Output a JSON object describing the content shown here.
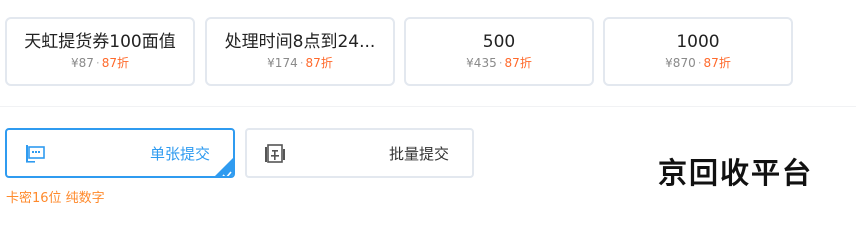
{
  "denominations": [
    {
      "title": "天虹提货券100面值",
      "price": "¥87",
      "separator": "·",
      "discount": "87折"
    },
    {
      "title": "处理时间8点到24...",
      "price": "¥174",
      "separator": "·",
      "discount": "87折"
    },
    {
      "title": "500",
      "price": "¥435",
      "separator": "·",
      "discount": "87折"
    },
    {
      "title": "1000",
      "price": "¥870",
      "separator": "·",
      "discount": "87折"
    }
  ],
  "submit_modes": {
    "single": {
      "label": "单张提交",
      "icon": "single-card-icon",
      "selected": true
    },
    "batch": {
      "label": "批量提交",
      "icon": "batch-card-icon",
      "selected": false
    }
  },
  "hint": "卡密16位 纯数字",
  "watermark": "京回收平台",
  "colors": {
    "accent": "#2f9bf0",
    "discount": "#ff6a2c",
    "hint": "#ff8a2c",
    "card_border": "#e3e8ef"
  }
}
